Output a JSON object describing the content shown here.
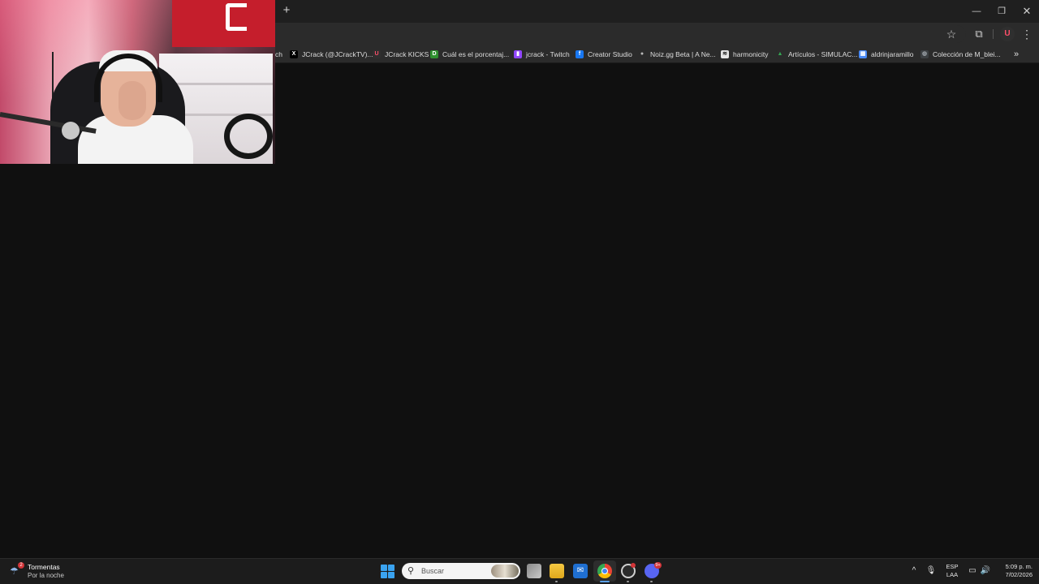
{
  "browser": {
    "new_tab_symbol": "+",
    "window_controls": {
      "minimize": "—",
      "restore": "❐",
      "close": "✕"
    },
    "toolbar": {
      "star": "☆",
      "extensions": "⧉",
      "profile": "U",
      "menu": "⋮"
    },
    "bookmarks": [
      {
        "label": "ch",
        "icon": "twitch-icon",
        "color": "#9146ff"
      },
      {
        "label": "JCrack (@JCrackTV)...",
        "icon": "x-icon",
        "color": "#000000",
        "glyph": "X"
      },
      {
        "label": "JCrack KICKS",
        "icon": "kick-profile-icon",
        "color": "#2f2f2f",
        "glyph": "U"
      },
      {
        "label": "Cuál es el porcentaj...",
        "icon": "kick-icon",
        "color": "#53fc18",
        "glyph": "D"
      },
      {
        "label": "jcrack - Twitch",
        "icon": "twitch-icon",
        "color": "#9146ff",
        "glyph": "▮"
      },
      {
        "label": "Creator Studio",
        "icon": "facebook-icon",
        "color": "#1877f2",
        "glyph": "f"
      },
      {
        "label": "Noiz.gg Beta | A Ne...",
        "icon": "noiz-icon",
        "color": "#2b2b2b",
        "glyph": "●"
      },
      {
        "label": "harmonicity",
        "icon": "harmonicity-icon",
        "color": "#e6e6e6",
        "glyph": "≋"
      },
      {
        "label": "Artículos - SIMULAC...",
        "icon": "google-drive-icon",
        "color": "#34a853",
        "glyph": "▲"
      },
      {
        "label": "aldrinjaramillo",
        "icon": "table-icon",
        "color": "#4a8af4",
        "glyph": "▦"
      },
      {
        "label": "Colección de M_blei...",
        "icon": "globe-icon",
        "color": "#3c4043",
        "glyph": "◍"
      }
    ],
    "bookmarks_more": "»"
  },
  "taskbar": {
    "weather": {
      "title": "Tormentas",
      "subtitle": "Por la noche",
      "badge": "2",
      "icon": "storm-cloud-icon"
    },
    "search": {
      "placeholder": "Buscar",
      "icon": "search-icon"
    },
    "apps": [
      {
        "name": "task-view",
        "icon": "task-view-icon"
      },
      {
        "name": "file-explorer",
        "icon": "folder-icon"
      },
      {
        "name": "mail",
        "icon": "mail-icon"
      },
      {
        "name": "chrome",
        "icon": "chrome-icon",
        "active": true
      },
      {
        "name": "obs",
        "icon": "obs-icon"
      },
      {
        "name": "discord",
        "icon": "discord-icon",
        "badge": "9+"
      }
    ],
    "tray": {
      "chevron": "^",
      "mic": "🎙",
      "language": {
        "line1": "ESP",
        "line2": "LAA"
      },
      "network": "▭",
      "volume": "🔊",
      "clock": {
        "time": "5:09 p. m.",
        "date": "7/02/2026"
      }
    }
  },
  "colors": {
    "accent": "#3aa3f0",
    "page_background": "#101010",
    "chrome_frame": "#1f1f1f",
    "toolbar": "#2b2b2b",
    "badge_red": "#d13438"
  }
}
